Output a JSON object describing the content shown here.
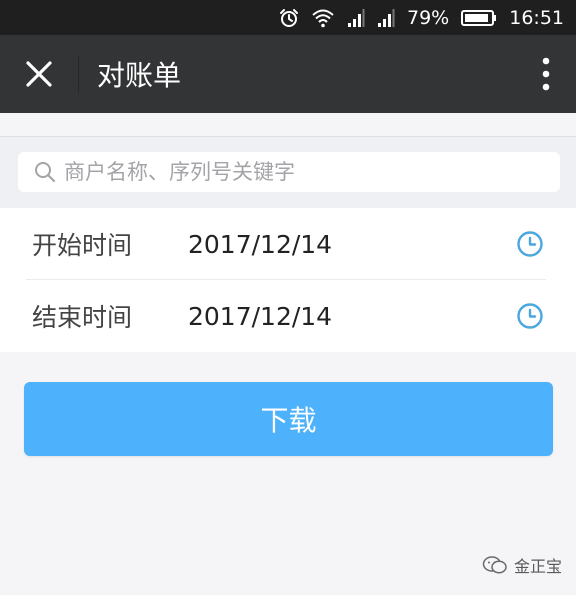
{
  "status_bar": {
    "battery_percent": "79%",
    "time": "16:51",
    "icons": [
      "alarm-icon",
      "wifi-icon",
      "signal-icon",
      "signal-icon",
      "battery-icon"
    ]
  },
  "header": {
    "title": "对账单",
    "close_icon": "close-icon",
    "more_icon": "more-vertical-icon"
  },
  "search": {
    "placeholder": "商户名称、序列号关键字",
    "value": ""
  },
  "date_range": {
    "start": {
      "label": "开始时间",
      "value": "2017/12/14"
    },
    "end": {
      "label": "结束时间",
      "value": "2017/12/14"
    }
  },
  "actions": {
    "download_label": "下载"
  },
  "watermark": {
    "text": "金正宝"
  },
  "colors": {
    "status_bar_bg": "#1f1f1f",
    "title_bar_bg": "#333436",
    "accent": "#4db2fb",
    "clock_icon": "#4aa8df"
  }
}
